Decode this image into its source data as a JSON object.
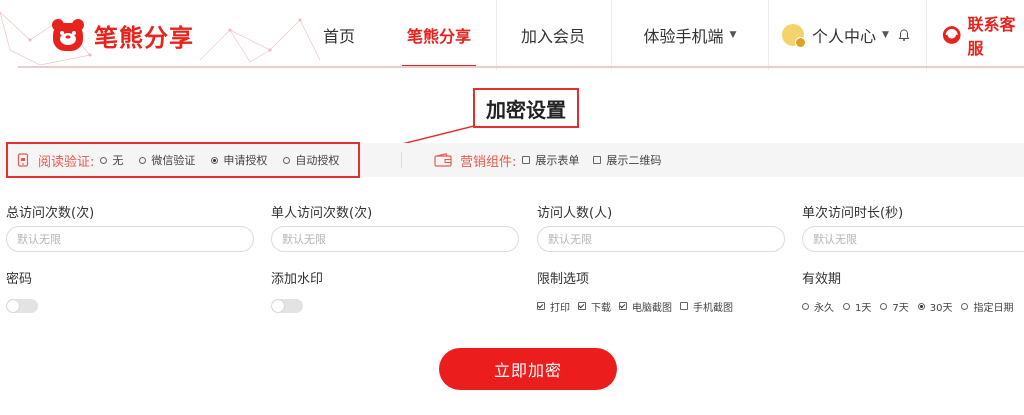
{
  "brand": {
    "name": "笔熊分享",
    "color": "#e8231d"
  },
  "nav": {
    "items": [
      {
        "label": "首页"
      },
      {
        "label": "笔熊分享"
      },
      {
        "label": "加入会员"
      },
      {
        "label": "体验手机端"
      }
    ],
    "user_center": "个人中心",
    "service": "联系客服"
  },
  "annotation": {
    "label": "加密设置"
  },
  "read_verify": {
    "title": "阅读验证:",
    "options": [
      "无",
      "微信验证",
      "申请授权",
      "自动授权"
    ],
    "selected": "申请授权"
  },
  "marketing": {
    "title": "营销组件:",
    "options": [
      "展示表单",
      "展示二维码"
    ]
  },
  "form": {
    "total_visits": {
      "label": "总访问次数(次)",
      "placeholder": "默认无限"
    },
    "single_person_visits": {
      "label": "单人访问次数(次)",
      "placeholder": "默认无限"
    },
    "visitors": {
      "label": "访问人数(人)",
      "placeholder": "默认无限"
    },
    "single_duration": {
      "label": "单次访问时长(秒)",
      "placeholder": "默认无限"
    },
    "password": {
      "label": "密码",
      "enabled": false
    },
    "watermark": {
      "label": "添加水印",
      "enabled": false
    },
    "restrictions": {
      "label": "限制选项",
      "options": [
        {
          "label": "打印",
          "checked": true
        },
        {
          "label": "下载",
          "checked": true
        },
        {
          "label": "电脑截图",
          "checked": true
        },
        {
          "label": "手机截图",
          "checked": false
        }
      ]
    },
    "validity": {
      "label": "有效期",
      "options": [
        "永久",
        "1天",
        "7天",
        "30天",
        "指定日期"
      ],
      "selected": "30天"
    }
  },
  "submit_label": "立即加密"
}
